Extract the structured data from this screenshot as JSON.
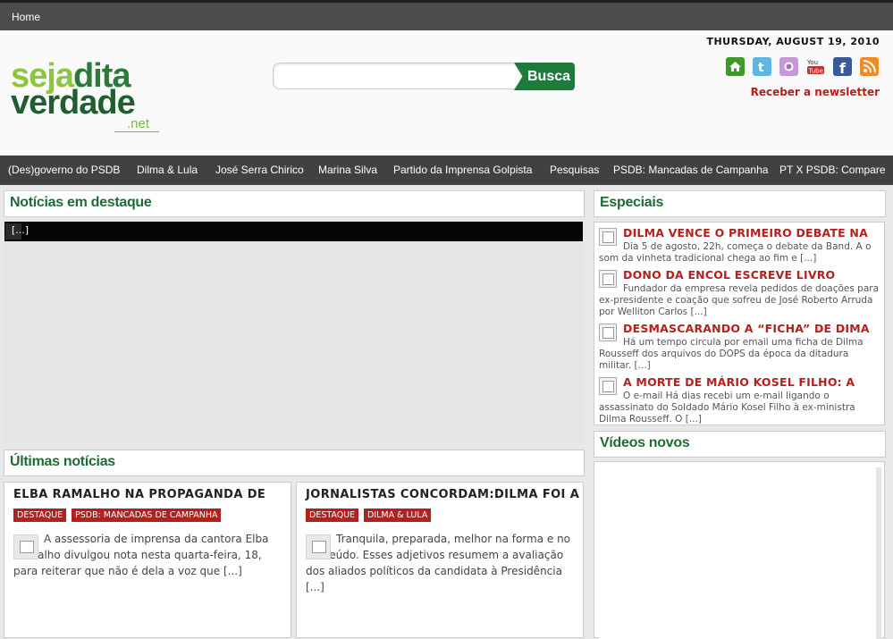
{
  "topbar": {
    "home": "Home"
  },
  "header": {
    "logo": {
      "line1a": "seja",
      "line1b": "dita",
      "line2": "verdade",
      "suffix": ".net"
    },
    "search_button": "Busca",
    "search_placeholder": "",
    "date": "THURSDAY, AUGUST 19, 2010",
    "newsletter": "Receber a newsletter",
    "social_icons": [
      "home-icon",
      "twitter-icon",
      "flickr-icon",
      "youtube-icon",
      "facebook-icon",
      "rss-icon"
    ]
  },
  "nav": {
    "items": [
      "(Des)governo do PSDB",
      "Dilma & Lula",
      "José Serra Chirico",
      "Marina Silva",
      "Partido da Imprensa Golpista",
      "Pesquisas",
      "PSDB: Mancadas de Campanha",
      "PT X PSDB: Compare"
    ]
  },
  "destaque": {
    "heading": "Notícias em destaque",
    "slider_text": "[...]"
  },
  "especiais": {
    "heading": "Especiais",
    "items": [
      {
        "title": "DILMA VENCE O PRIMEIRO DEBATE NA",
        "text": "Dia 5 de agosto, 22h, começa o debate da Band. A o som da vinheta tradicional chega ao fim  e [...]"
      },
      {
        "title": "DONO DA ENCOL ESCREVE LIVRO",
        "text": "Fundador da empresa revela pedidos de doações para ex-presidente e coação que sofreu de José Roberto Arruda por Welliton Carlos [...]"
      },
      {
        "title": "DESMASCARANDO A “FICHA” DE DIMA",
        "text": "Há um tempo circula por email uma ficha de Dilma Rousseff dos arquivos do DOPS da época da ditadura militar. [...]"
      },
      {
        "title": "A MORTE DE MÁRIO KOSEL FILHO: A",
        "text": "O e-mail Há dias recebi um e-mail ligando o assassinato do Soldado Mário Kosel Filho à ex-ministra Dilma Rousseff. O [...]"
      }
    ]
  },
  "videos": {
    "heading": "Vídeos novos"
  },
  "ultimas": {
    "heading": "Últimas notícias",
    "items": [
      {
        "title": "ELBA RAMALHO NA PROPAGANDA DE",
        "tags": [
          "DESTAQUE",
          "PSDB: MANCADAS DE CAMPANHA"
        ],
        "excerpt": "A assessoria de imprensa da cantora Elba Ramalho divulgou nota nesta quarta-feira, 18, para reiterar que não é dela a voz que [...]"
      },
      {
        "title": "JORNALISTAS CONCORDAM:DILMA FOI A",
        "tags": [
          "DESTAQUE",
          "DILMA & LULA"
        ],
        "excerpt": "Tranquila, preparada, melhor na forma e no conteúdo. Esses adjetivos resumem a avaliação dos aliados políticos da candidata à Presidência [...]"
      }
    ]
  },
  "colors": {
    "accent_green": "#1f6b35",
    "accent_red": "#b3201d",
    "nav_bg": "#3f4143"
  }
}
